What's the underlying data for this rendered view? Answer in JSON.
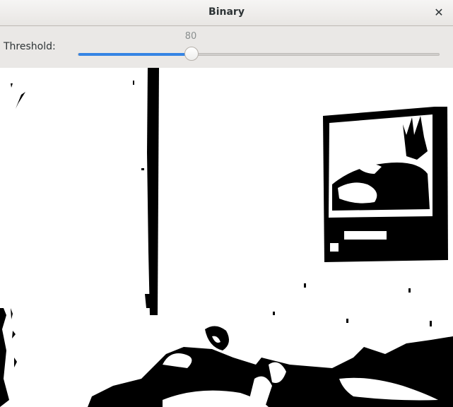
{
  "window": {
    "title": "Binary",
    "close_icon": "close-icon"
  },
  "toolbar": {
    "threshold_label": "Threshold:",
    "threshold_value": "80",
    "threshold_fraction": 0.314
  },
  "image": {
    "description_icon": "binary-threshold-image"
  }
}
